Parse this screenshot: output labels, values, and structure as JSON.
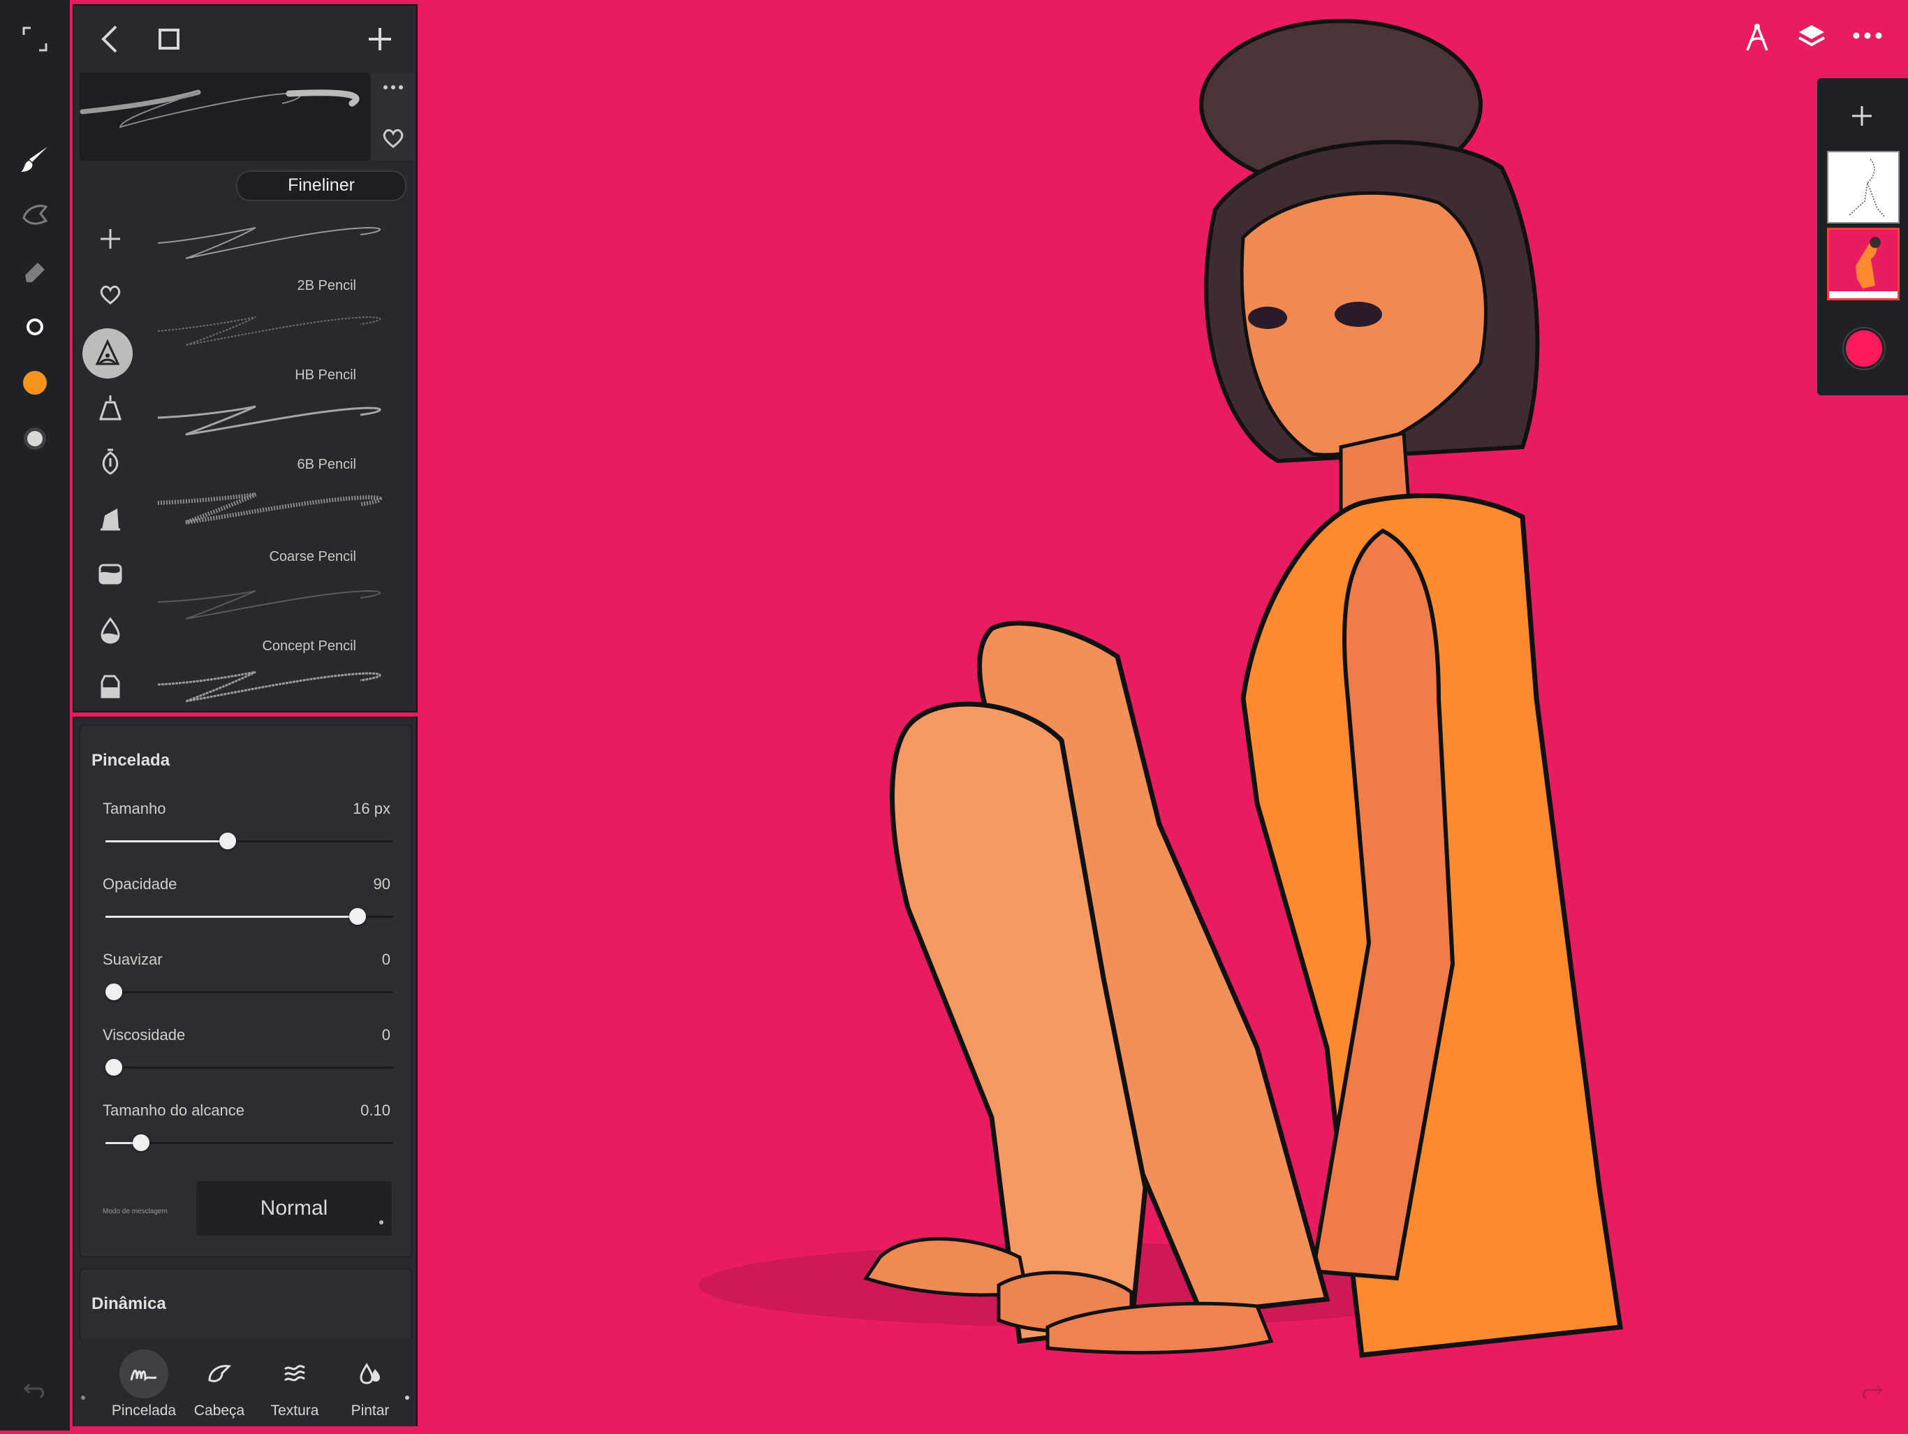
{
  "brush_panel": {
    "preset_name": "Fineliner",
    "brushes": [
      {
        "label": "2B Pencil"
      },
      {
        "label": "HB Pencil"
      },
      {
        "label": "6B Pencil"
      },
      {
        "label": "Coarse Pencil"
      },
      {
        "label": "Concept Pencil"
      }
    ]
  },
  "properties": {
    "section_title": "Pincelada",
    "sliders": [
      {
        "label": "Tamanho",
        "value": "16 px",
        "fraction": 0.42
      },
      {
        "label": "Opacidade",
        "value": "90",
        "fraction": 0.9
      },
      {
        "label": "Suavizar",
        "value": "0",
        "fraction": 0.0
      },
      {
        "label": "Viscosidade",
        "value": "0",
        "fraction": 0.0
      },
      {
        "label": "Tamanho do alcance",
        "value": "0.10",
        "fraction": 0.1
      }
    ],
    "blend_mode_label": "Modo de mesclagem",
    "blend_mode_value": "Normal",
    "next_section_title": "Dinâmica"
  },
  "tabs": [
    {
      "label": "Pincelada",
      "icon": "stroke-icon"
    },
    {
      "label": "Cabeça",
      "icon": "head-icon"
    },
    {
      "label": "Textura",
      "icon": "texture-icon"
    },
    {
      "label": "Pintar",
      "icon": "paint-icon"
    }
  ],
  "colors": {
    "canvas": "#e81c5e",
    "primary": "#f7941d",
    "secondary_ring": "#ffffff",
    "layer_color": "#ff1a5c"
  }
}
